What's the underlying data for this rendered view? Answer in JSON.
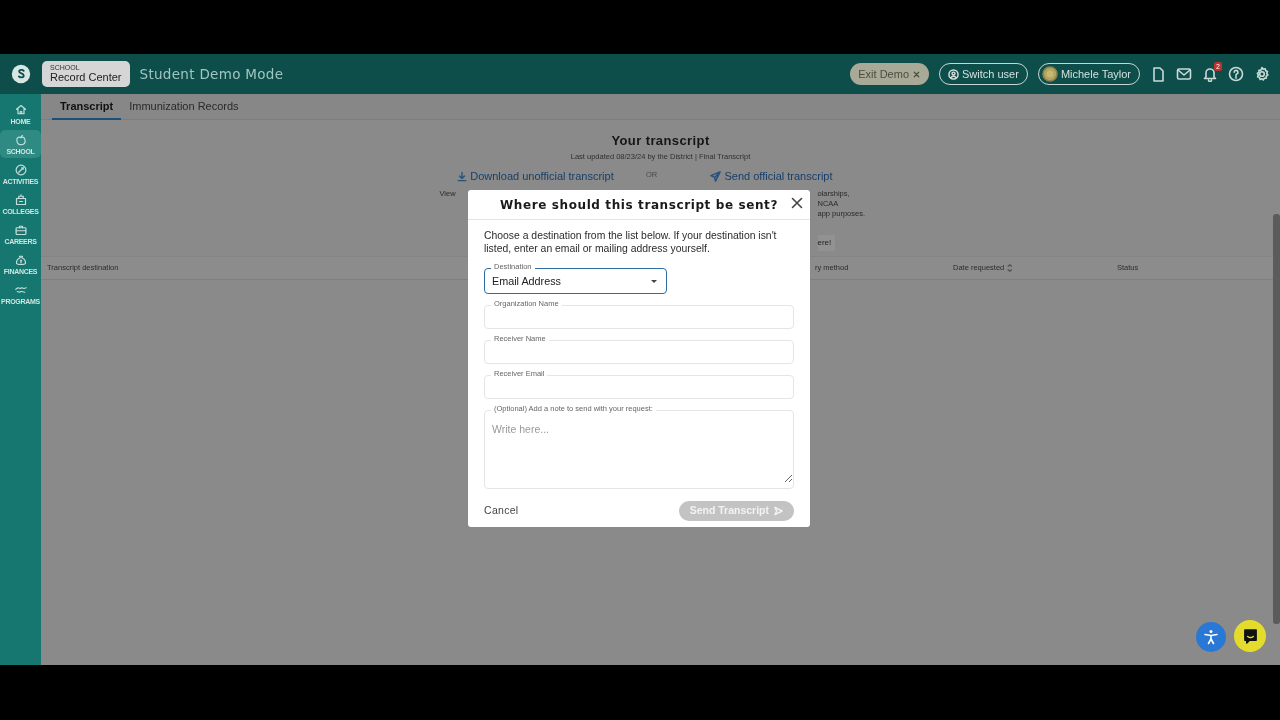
{
  "topbar": {
    "module_label": "SCHOOL",
    "module": "Record Center",
    "title": "Student Demo Mode",
    "exit_demo": "Exit Demo",
    "switch_user": "Switch user",
    "user": "Michele Taylor",
    "notifications": "2"
  },
  "sidebar": {
    "items": [
      {
        "label": "HOME",
        "selected": false
      },
      {
        "label": "SCHOOL",
        "selected": true
      },
      {
        "label": "ACTIVITIES",
        "selected": false
      },
      {
        "label": "COLLEGES",
        "selected": false
      },
      {
        "label": "CAREERS",
        "selected": false
      },
      {
        "label": "FINANCES",
        "selected": false
      },
      {
        "label": "PROGRAMS",
        "selected": false
      }
    ]
  },
  "tabs": [
    {
      "label": "Transcript",
      "selected": true
    },
    {
      "label": "Immunization Records",
      "selected": false
    }
  ],
  "transcript": {
    "title": "Your transcript",
    "updated": "Last updated 08/23/24 by the District | Final Transcript",
    "download_link": "Download unofficial transcript",
    "download_desc": "View",
    "or": "OR",
    "send_link": "Send official transcript",
    "send_desc": [
      "olarships, NCAA",
      "app purposes."
    ],
    "help_button": "ere!"
  },
  "table": {
    "columns": [
      {
        "label": "Transcript destination",
        "sortable": false
      },
      {
        "label": "ry method",
        "sortable": false
      },
      {
        "label": "Date requested",
        "sortable": true
      },
      {
        "label": "Status",
        "sortable": false
      }
    ]
  },
  "modal": {
    "title": "Where should this transcript be sent?",
    "intro": "Choose a destination from the list below. If your destination isn't listed, enter an email or mailing address yourself.",
    "destination": {
      "label": "Destination",
      "value": "Email Address"
    },
    "fields": [
      {
        "label": "Organization Name"
      },
      {
        "label": "Receiver Name"
      },
      {
        "label": "Receiver Email"
      }
    ],
    "note": {
      "label": "(Optional) Add a note to send with your request:",
      "placeholder": "Write here..."
    },
    "cancel": "Cancel",
    "submit": {
      "label": "Send Transcript",
      "disabled": true
    }
  }
}
